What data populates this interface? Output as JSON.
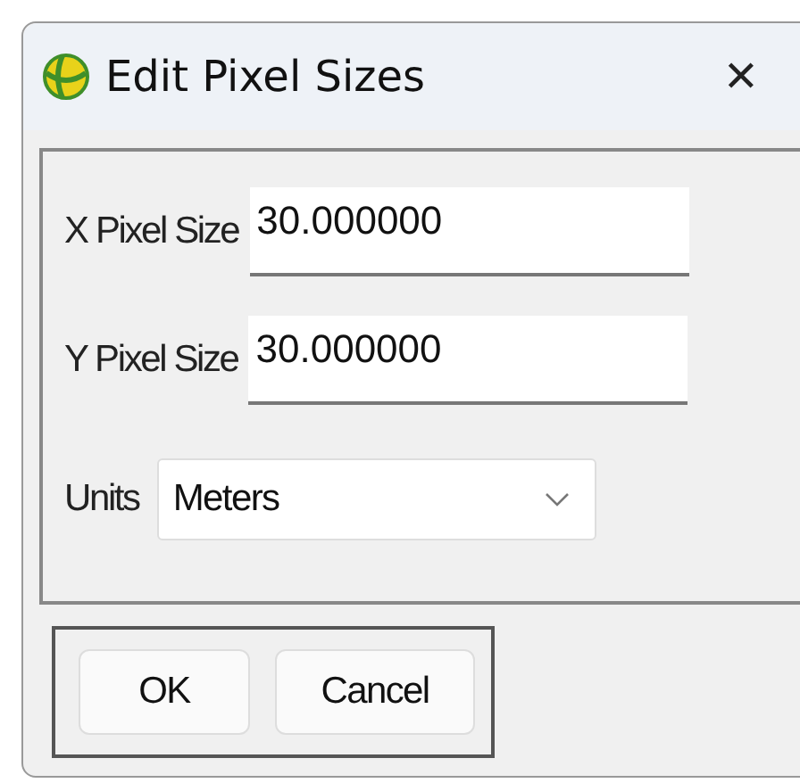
{
  "window": {
    "title": "Edit Pixel Sizes",
    "close": "✕"
  },
  "fields": [
    {
      "label": "X Pixel Size",
      "value": "30.000000"
    },
    {
      "label": "Y Pixel Size",
      "value": "30.000000"
    }
  ],
  "units": {
    "label": "Units",
    "value": "Meters"
  },
  "buttons": [
    "OK",
    "Cancel"
  ]
}
